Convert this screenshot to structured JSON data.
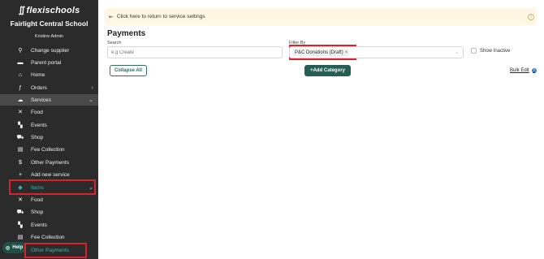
{
  "brand": {
    "name": "flexischools"
  },
  "sidebar": {
    "school_name": "Fairlight Central School",
    "user_name": "Kristine Admin",
    "items": [
      {
        "label": "Change supplier",
        "icon": "location-pin-icon"
      },
      {
        "label": "Parent portal",
        "icon": "sofa-icon"
      },
      {
        "label": "Home",
        "icon": "home-icon"
      },
      {
        "label": "Orders",
        "icon": "orders-icon"
      },
      {
        "label": "Services",
        "icon": "services-icon"
      },
      {
        "label": "Food",
        "icon": "utensils-icon"
      },
      {
        "label": "Events",
        "icon": "ticket-icon"
      },
      {
        "label": "Shop",
        "icon": "cart-icon"
      },
      {
        "label": "Fee Collection",
        "icon": "receipt-icon"
      },
      {
        "label": "Other Payments",
        "icon": "dollar-icon"
      },
      {
        "label": "Add new service",
        "icon": "plus-icon"
      },
      {
        "label": "Items",
        "icon": "tag-icon"
      },
      {
        "label": "Food",
        "icon": "utensils-icon"
      },
      {
        "label": "Shop",
        "icon": "cart-icon"
      },
      {
        "label": "Events",
        "icon": "ticket-icon"
      },
      {
        "label": "Fee Collection",
        "icon": "receipt-icon"
      },
      {
        "label": "Other Payments",
        "icon": "dollar-icon"
      }
    ],
    "help_label": "Help"
  },
  "banner": {
    "text": "Click here to return to service settings"
  },
  "main": {
    "title": "Payments",
    "search_label": "Search",
    "search_placeholder": "e.g Create",
    "filter_label": "Filter By",
    "filter_chip": "P&C Donations (Draft)",
    "show_inactive_label": "Show Inactive",
    "collapse_label": "Collapse All",
    "add_category_label": "+Add Category",
    "bulk_edit_label": "Bulk Edit"
  },
  "colors": {
    "sidebar_bg": "#2b2b2b",
    "accent": "#245e55",
    "highlight": "#d8232a",
    "active_text": "#39b8ad"
  }
}
